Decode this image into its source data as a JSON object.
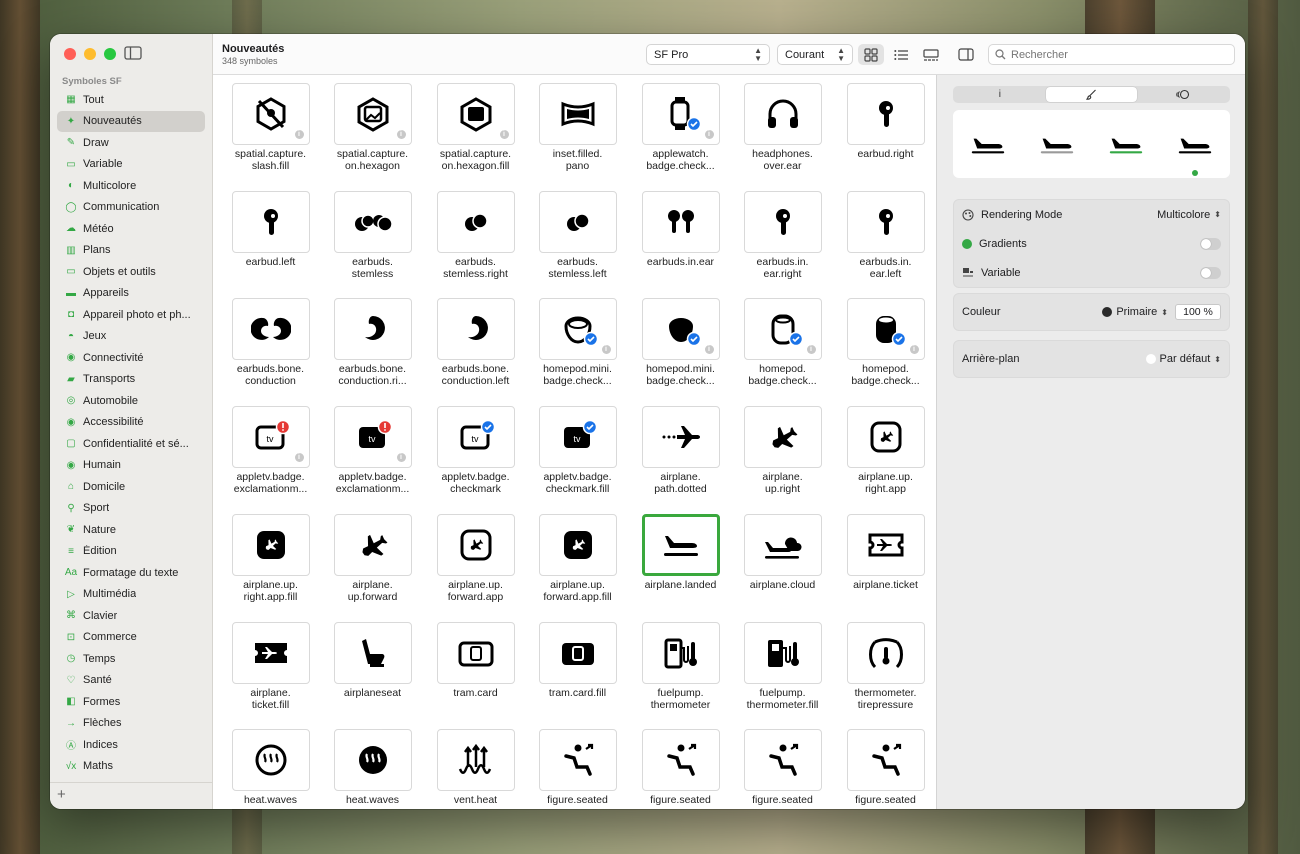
{
  "sidebar": {
    "section_title": "Symboles SF",
    "items": [
      {
        "label": "Tout",
        "icon": "grid-icon",
        "glyph": "▦"
      },
      {
        "label": "Nouveautés",
        "icon": "sparkles-icon",
        "glyph": "✦",
        "selected": true
      },
      {
        "label": "Draw",
        "icon": "pencil-icon",
        "glyph": "✎"
      },
      {
        "label": "Variable",
        "icon": "slider-icon",
        "glyph": "▭"
      },
      {
        "label": "Multicolore",
        "icon": "palette-icon",
        "glyph": "◐"
      },
      {
        "label": "Communication",
        "icon": "bubble-icon",
        "glyph": "◯"
      },
      {
        "label": "Météo",
        "icon": "cloud-icon",
        "glyph": "☁"
      },
      {
        "label": "Plans",
        "icon": "map-icon",
        "glyph": "▥"
      },
      {
        "label": "Objets et outils",
        "icon": "folder-icon",
        "glyph": "▭"
      },
      {
        "label": "Appareils",
        "icon": "display-icon",
        "glyph": "▬"
      },
      {
        "label": "Appareil photo et ph...",
        "icon": "camera-icon",
        "glyph": "◘"
      },
      {
        "label": "Jeux",
        "icon": "gamecontroller-icon",
        "glyph": "◓"
      },
      {
        "label": "Connectivité",
        "icon": "antenna-icon",
        "glyph": "◉"
      },
      {
        "label": "Transports",
        "icon": "car-icon",
        "glyph": "▰"
      },
      {
        "label": "Automobile",
        "icon": "steering-icon",
        "glyph": "◎"
      },
      {
        "label": "Accessibilité",
        "icon": "accessibility-icon",
        "glyph": "◉"
      },
      {
        "label": "Confidentialité et sé...",
        "icon": "lock-icon",
        "glyph": "▢"
      },
      {
        "label": "Humain",
        "icon": "person-icon",
        "glyph": "◉"
      },
      {
        "label": "Domicile",
        "icon": "house-icon",
        "glyph": "⌂"
      },
      {
        "label": "Sport",
        "icon": "figure-run-icon",
        "glyph": "⚲"
      },
      {
        "label": "Nature",
        "icon": "leaf-icon",
        "glyph": "❦"
      },
      {
        "label": "Édition",
        "icon": "slider-horizontal-icon",
        "glyph": "≡"
      },
      {
        "label": "Formatage du texte",
        "icon": "textformat-icon",
        "glyph": "Aa"
      },
      {
        "label": "Multimédia",
        "icon": "playpause-icon",
        "glyph": "▷"
      },
      {
        "label": "Clavier",
        "icon": "command-icon",
        "glyph": "⌘"
      },
      {
        "label": "Commerce",
        "icon": "cart-icon",
        "glyph": "⊡"
      },
      {
        "label": "Temps",
        "icon": "clock-icon",
        "glyph": "◷"
      },
      {
        "label": "Santé",
        "icon": "heart-icon",
        "glyph": "♡"
      },
      {
        "label": "Formes",
        "icon": "square-circle-icon",
        "glyph": "◧"
      },
      {
        "label": "Flèches",
        "icon": "arrow-icon",
        "glyph": "→"
      },
      {
        "label": "Indices",
        "icon": "a-circle-icon",
        "glyph": "Ⓐ"
      },
      {
        "label": "Maths",
        "icon": "function-icon",
        "glyph": "√x"
      }
    ]
  },
  "toolbar": {
    "title": "Nouveautés",
    "subtitle": "348 symboles",
    "font_popup": "SF Pro",
    "weight_popup": "Courant",
    "search_placeholder": "Rechercher"
  },
  "symbols": [
    {
      "name": "spatial.capture.\nslash.fill",
      "icon": "slash",
      "info": true
    },
    {
      "name": "spatial.capture.\non.hexagon",
      "icon": "hex",
      "info": true
    },
    {
      "name": "spatial.capture.\non.hexagon.fill",
      "icon": "hexfill",
      "info": true
    },
    {
      "name": "inset.filled.\npano",
      "icon": "pano",
      "info": false
    },
    {
      "name": "applewatch.\nbadge.check...",
      "icon": "watch",
      "info": true
    },
    {
      "name": "headphones.\nover.ear",
      "icon": "headphones",
      "info": false
    },
    {
      "name": "earbud.right",
      "icon": "earbud",
      "info": false
    },
    {
      "name": "earbud.left",
      "icon": "earbud",
      "info": false
    },
    {
      "name": "earbuds.\nstemless",
      "icon": "stemless2",
      "info": false
    },
    {
      "name": "earbuds.\nstemless.right",
      "icon": "stemless1",
      "info": false
    },
    {
      "name": "earbuds.\nstemless.left",
      "icon": "stemless1",
      "info": false
    },
    {
      "name": "earbuds.in.ear",
      "icon": "earbuds2",
      "info": false
    },
    {
      "name": "earbuds.in.\near.right",
      "icon": "earbud",
      "info": false
    },
    {
      "name": "earbuds.in.\near.left",
      "icon": "earbud",
      "info": false
    },
    {
      "name": "earbuds.bone.\nconduction",
      "icon": "bone2",
      "info": false
    },
    {
      "name": "earbuds.bone.\nconduction.ri...",
      "icon": "bone1",
      "info": false
    },
    {
      "name": "earbuds.bone.\nconduction.left",
      "icon": "bone1",
      "info": false
    },
    {
      "name": "homepod.mini.\nbadge.check...",
      "icon": "homepodmini",
      "info": true
    },
    {
      "name": "homepod.mini.\nbadge.check...",
      "icon": "homepodminifill",
      "info": true
    },
    {
      "name": "homepod.\nbadge.check...",
      "icon": "homepod",
      "info": true
    },
    {
      "name": "homepod.\nbadge.check...",
      "icon": "homepodfill",
      "info": true
    },
    {
      "name": "appletv.badge.\nexclamationm...",
      "icon": "tvred",
      "info": true
    },
    {
      "name": "appletv.badge.\nexclamationm...",
      "icon": "tvredfill",
      "info": true
    },
    {
      "name": "appletv.badge.\ncheckmark",
      "icon": "tvblue",
      "info": false
    },
    {
      "name": "appletv.badge.\ncheckmark.fill",
      "icon": "tvbluefill",
      "info": false
    },
    {
      "name": "airplane.\npath.dotted",
      "icon": "planedotted",
      "info": false
    },
    {
      "name": "airplane.\nup.right",
      "icon": "planeupright",
      "info": false
    },
    {
      "name": "airplane.up.\nright.app",
      "icon": "planeapp",
      "info": false
    },
    {
      "name": "airplane.up.\nright.app.fill",
      "icon": "planeappfill",
      "info": false
    },
    {
      "name": "airplane.\nup.forward",
      "icon": "planeupright",
      "info": false
    },
    {
      "name": "airplane.up.\nforward.app",
      "icon": "planeapp",
      "info": false
    },
    {
      "name": "airplane.up.\nforward.app.fill",
      "icon": "planeappfill",
      "info": false
    },
    {
      "name": "airplane.landed",
      "icon": "landed",
      "info": false,
      "selected": true
    },
    {
      "name": "airplane.cloud",
      "icon": "planecloud",
      "info": false
    },
    {
      "name": "airplane.ticket",
      "icon": "ticket",
      "info": false
    },
    {
      "name": "airplane.\nticket.fill",
      "icon": "ticketfill",
      "info": false
    },
    {
      "name": "airplaneseat",
      "icon": "seat",
      "info": false
    },
    {
      "name": "tram.card",
      "icon": "tramcard",
      "info": false
    },
    {
      "name": "tram.card.fill",
      "icon": "tramcardfill",
      "info": false
    },
    {
      "name": "fuelpump.\nthermometer",
      "icon": "fuel",
      "info": false
    },
    {
      "name": "fuelpump.\nthermometer.fill",
      "icon": "fuelfill",
      "info": false
    },
    {
      "name": "thermometer.\ntirepressure",
      "icon": "tire",
      "info": false
    },
    {
      "name": "heat.waves",
      "icon": "heatwaves",
      "info": false
    },
    {
      "name": "heat.waves",
      "icon": "heatwavesfill",
      "info": false
    },
    {
      "name": "vent.heat",
      "icon": "vent",
      "info": false
    },
    {
      "name": "figure.seated",
      "icon": "seated",
      "info": false
    },
    {
      "name": "figure.seated",
      "icon": "seated",
      "info": false
    },
    {
      "name": "figure.seated",
      "icon": "seated",
      "info": false
    },
    {
      "name": "figure.seated",
      "icon": "seated",
      "info": false
    }
  ],
  "inspector": {
    "tabs": [
      "i",
      "paintbrush-icon",
      "variable-icon"
    ],
    "rendering_mode_label": "Rendering Mode",
    "rendering_mode_value": "Multicolore",
    "gradients_label": "Gradients",
    "variable_label": "Variable",
    "couleur_label": "Couleur",
    "couleur_value": "Primaire",
    "opacity_value": "100 %",
    "background_label": "Arrière-plan",
    "background_value": "Par défaut",
    "accent": "#34a845"
  }
}
